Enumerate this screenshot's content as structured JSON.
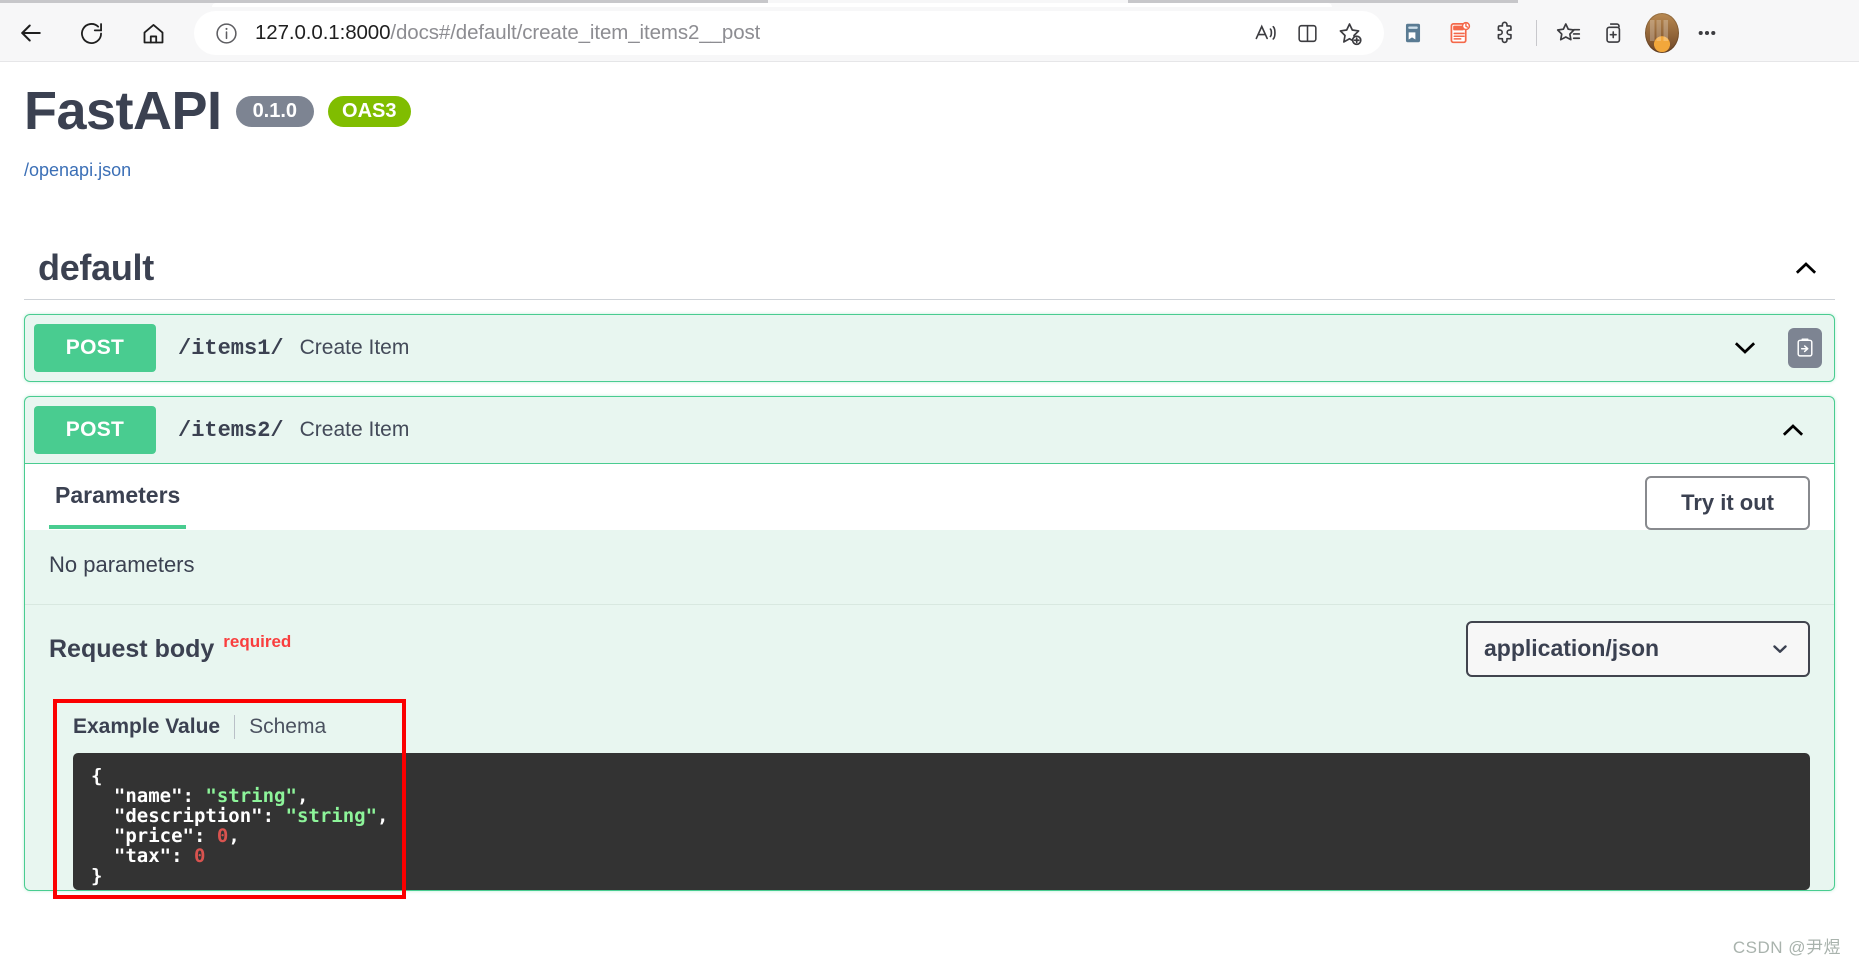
{
  "browser": {
    "back_icon": "arrow-left-icon",
    "reload_icon": "reload-icon",
    "home_icon": "home-icon",
    "info_icon": "info-circle-icon",
    "url_host": "127.0.0.1:8000",
    "url_path": "/docs#/default/create_item_items2__post",
    "url_full": "127.0.0.1:8000/docs#/default/create_item_items2__post",
    "read_aloud_icon": "read-aloud-icon",
    "split_screen_icon": "split-screen-icon",
    "add_favorite_icon": "add-favorite-star-icon",
    "collections_icon": "collections-icon",
    "pdf_icon": "pdf-tool-icon",
    "extensions_icon": "extensions-puzzle-icon",
    "favorites_icon": "favorites-star-list-icon",
    "add_tab_group_icon": "add-tab-group-icon",
    "profile_icon": "profile-avatar",
    "more_icon": "more-ellipsis-icon"
  },
  "api": {
    "title": "FastAPI",
    "version": "0.1.0",
    "spec_badge": "OAS3",
    "openapi_link": "/openapi.json"
  },
  "tag_section": {
    "name": "default",
    "collapse_icon": "chevron-up-icon"
  },
  "operations": [
    {
      "method": "POST",
      "path": "/items1/",
      "summary": "Create Item",
      "expanded": false,
      "toggle_icon": "chevron-down-icon",
      "auth_icon": "authorize-clipboard-icon"
    },
    {
      "method": "POST",
      "path": "/items2/",
      "summary": "Create Item",
      "expanded": true,
      "toggle_icon": "chevron-up-icon"
    }
  ],
  "operation_detail": {
    "parameters_tab": "Parameters",
    "try_it_out_label": "Try it out",
    "no_parameters_text": "No parameters",
    "request_body_label": "Request body",
    "required_label": "required",
    "content_type_value": "application/json",
    "content_type_chevron": "chevron-down-icon",
    "example_value_tab": "Example Value",
    "schema_tab": "Schema",
    "example_json_lines": [
      {
        "indent": 0,
        "parts": [
          {
            "t": "{",
            "c": "pun"
          }
        ]
      },
      {
        "indent": 1,
        "parts": [
          {
            "t": "\"name\"",
            "c": "key"
          },
          {
            "t": ": ",
            "c": "pun"
          },
          {
            "t": "\"string\"",
            "c": "str"
          },
          {
            "t": ",",
            "c": "pun"
          }
        ]
      },
      {
        "indent": 1,
        "parts": [
          {
            "t": "\"description\"",
            "c": "key"
          },
          {
            "t": ": ",
            "c": "pun"
          },
          {
            "t": "\"string\"",
            "c": "str"
          },
          {
            "t": ",",
            "c": "pun"
          }
        ]
      },
      {
        "indent": 1,
        "parts": [
          {
            "t": "\"price\"",
            "c": "key"
          },
          {
            "t": ": ",
            "c": "pun"
          },
          {
            "t": "0",
            "c": "num"
          },
          {
            "t": ",",
            "c": "pun"
          }
        ]
      },
      {
        "indent": 1,
        "parts": [
          {
            "t": "\"tax\"",
            "c": "key"
          },
          {
            "t": ": ",
            "c": "pun"
          },
          {
            "t": "0",
            "c": "num"
          }
        ]
      },
      {
        "indent": 0,
        "parts": [
          {
            "t": "}",
            "c": "pun"
          }
        ]
      }
    ]
  },
  "annotation": {
    "highlight_color": "#fb0000",
    "watermark": "CSDN @尹煜"
  },
  "colors": {
    "post_green": "#49cc90",
    "post_block_bg": "#e8f6f0",
    "version_badge": "#7d8492",
    "oas_badge": "#80bd00",
    "required_red": "#f93e3e",
    "text_dark": "#3b4151",
    "code_bg": "#333333",
    "code_string": "#8df49a",
    "code_number": "#d9534f"
  }
}
